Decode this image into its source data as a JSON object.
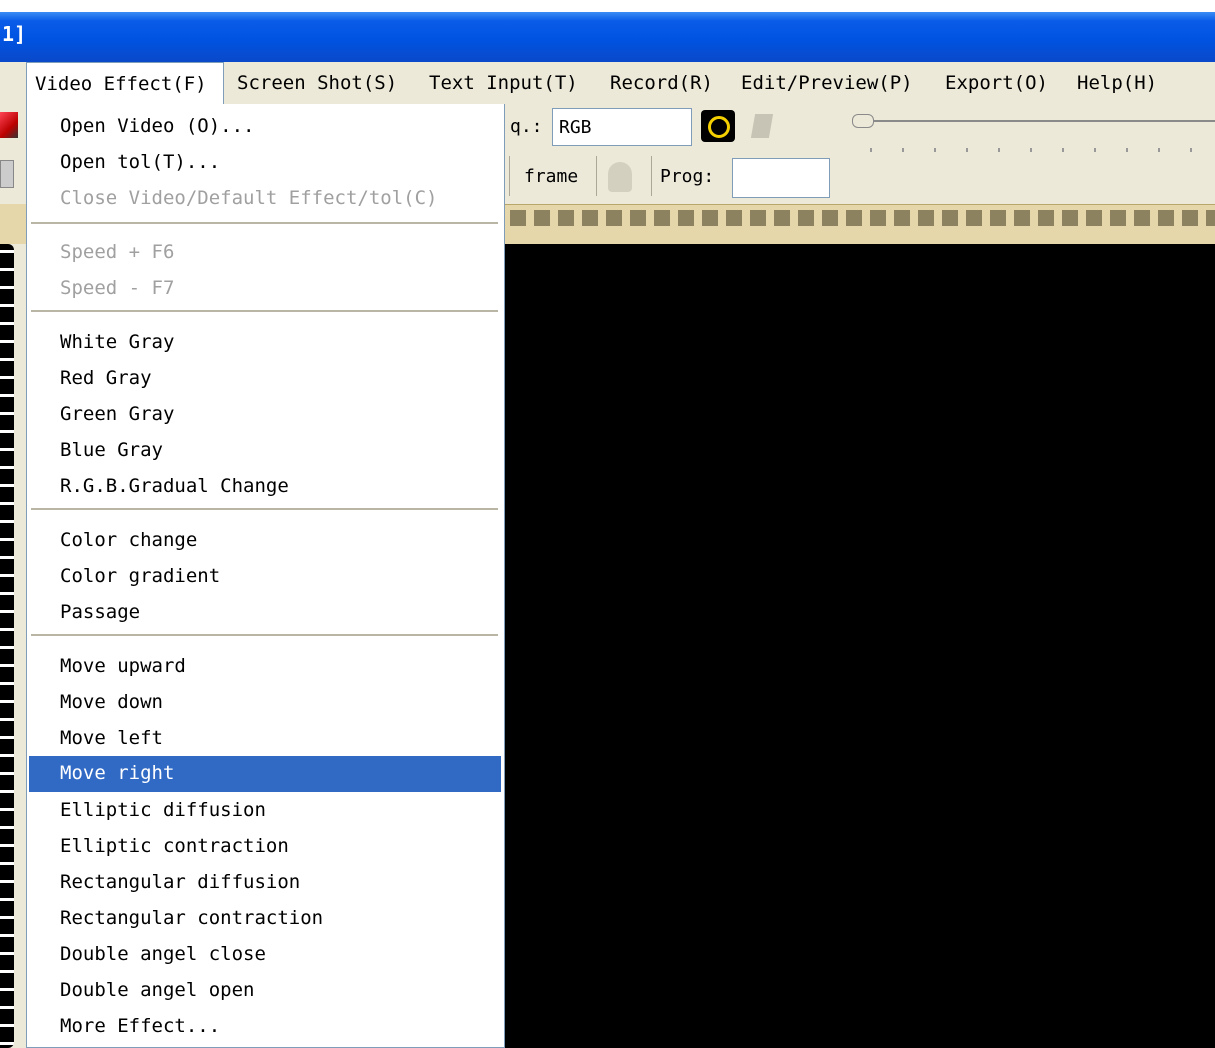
{
  "window": {
    "title_fragment": "1]"
  },
  "menubar": {
    "items": [
      {
        "label": "Video Effect(F)",
        "name": "menu-video-effect"
      },
      {
        "label": "Screen Shot(S)",
        "name": "menu-screen-shot"
      },
      {
        "label": "Text Input(T)",
        "name": "menu-text-input"
      },
      {
        "label": "Record(R)",
        "name": "menu-record"
      },
      {
        "label": "Edit/Preview(P)",
        "name": "menu-edit-preview"
      },
      {
        "label": "Export(O)",
        "name": "menu-export"
      },
      {
        "label": "Help(H)",
        "name": "menu-help"
      }
    ]
  },
  "toolbar": {
    "freq_label_fragment": "q.:",
    "color_mode_value": "RGB",
    "frame_label": "frame",
    "prog_label": "Prog:",
    "prog_value": ""
  },
  "dropdown": {
    "groups": [
      [
        {
          "label": "Open Video (O)...",
          "disabled": false
        },
        {
          "label": "Open tol(T)...",
          "disabled": false
        },
        {
          "label": "Close Video/Default Effect/tol(C)",
          "disabled": true
        }
      ],
      [
        {
          "label": "Speed + F6",
          "disabled": true
        },
        {
          "label": "Speed - F7",
          "disabled": true
        }
      ],
      [
        {
          "label": "White Gray",
          "disabled": false
        },
        {
          "label": "Red Gray",
          "disabled": false
        },
        {
          "label": "Green Gray",
          "disabled": false
        },
        {
          "label": "Blue Gray",
          "disabled": false
        },
        {
          "label": "R.G.B.Gradual Change",
          "disabled": false
        }
      ],
      [
        {
          "label": "Color change",
          "disabled": false
        },
        {
          "label": "Color gradient",
          "disabled": false
        },
        {
          "label": "Passage",
          "disabled": false
        }
      ],
      [
        {
          "label": "Move upward",
          "disabled": false
        },
        {
          "label": "Move down",
          "disabled": false
        },
        {
          "label": "Move left",
          "disabled": false
        },
        {
          "label": "Move right",
          "disabled": false,
          "highlighted": true
        },
        {
          "label": "Elliptic diffusion",
          "disabled": false
        },
        {
          "label": "Elliptic contraction",
          "disabled": false
        },
        {
          "label": "Rectangular diffusion",
          "disabled": false
        },
        {
          "label": "Rectangular contraction",
          "disabled": false
        },
        {
          "label": "Double angel close",
          "disabled": false
        },
        {
          "label": "Double angel open",
          "disabled": false
        },
        {
          "label": "More Effect...",
          "disabled": false
        }
      ]
    ]
  },
  "colors": {
    "titlebar": "#0053e1",
    "menu_highlight": "#316ac5",
    "video_background": "#000000",
    "filmstrip": "#e5d7a9"
  }
}
